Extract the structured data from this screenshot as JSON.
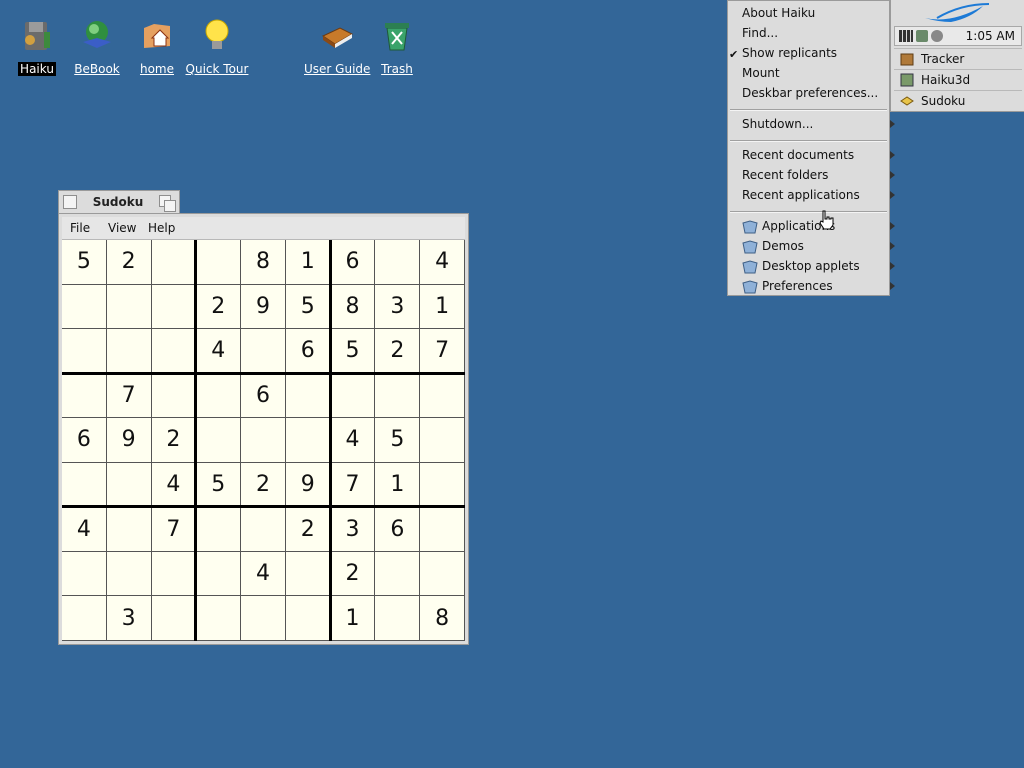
{
  "desktop": {
    "icons": [
      {
        "label": "Haiku",
        "selected": true
      },
      {
        "label": "BeBook"
      },
      {
        "label": "home"
      },
      {
        "label": "Quick Tour"
      },
      {
        "label": "User Guide"
      },
      {
        "label": "Trash"
      }
    ]
  },
  "window": {
    "title": "Sudoku",
    "menu": [
      "File",
      "View",
      "Help"
    ]
  },
  "sudoku": {
    "rows": [
      [
        "5",
        "2",
        "",
        "",
        "8",
        "1",
        "6",
        "",
        "4"
      ],
      [
        "",
        "",
        "",
        "2",
        "9",
        "5",
        "8",
        "3",
        "1"
      ],
      [
        "",
        "",
        "",
        "4",
        "",
        "6",
        "5",
        "2",
        "7"
      ],
      [
        "",
        "7",
        "",
        "",
        "6",
        "",
        "",
        "",
        ""
      ],
      [
        "6",
        "9",
        "2",
        "",
        "",
        "",
        "4",
        "5",
        ""
      ],
      [
        "",
        "",
        "4",
        "5",
        "2",
        "9",
        "7",
        "1",
        ""
      ],
      [
        "4",
        "",
        "7",
        "",
        "",
        "2",
        "3",
        "6",
        ""
      ],
      [
        "",
        "",
        "",
        "",
        "4",
        "",
        "2",
        "",
        ""
      ],
      [
        "",
        "3",
        "",
        "",
        "",
        "",
        "1",
        "",
        "8"
      ]
    ]
  },
  "deskbar": {
    "clock": "1:05 AM",
    "teams": [
      {
        "label": "Tracker",
        "icon": "tracker-icon"
      },
      {
        "label": "Haiku3d",
        "icon": "haiku3d-icon"
      },
      {
        "label": "Sudoku",
        "icon": "sudoku-icon"
      }
    ]
  },
  "leaf_menu": {
    "items": [
      "About Haiku",
      "Find...",
      "Show replicants",
      "Mount",
      "Deskbar preferences...",
      "Shutdown...",
      "Recent documents",
      "Recent folders",
      "Recent applications",
      "Applications",
      "Demos",
      "Desktop applets",
      "Preferences"
    ]
  },
  "colors": {
    "desktop": "#336698",
    "grid_background": "#fffff0",
    "panel": "#dcdcdc"
  }
}
